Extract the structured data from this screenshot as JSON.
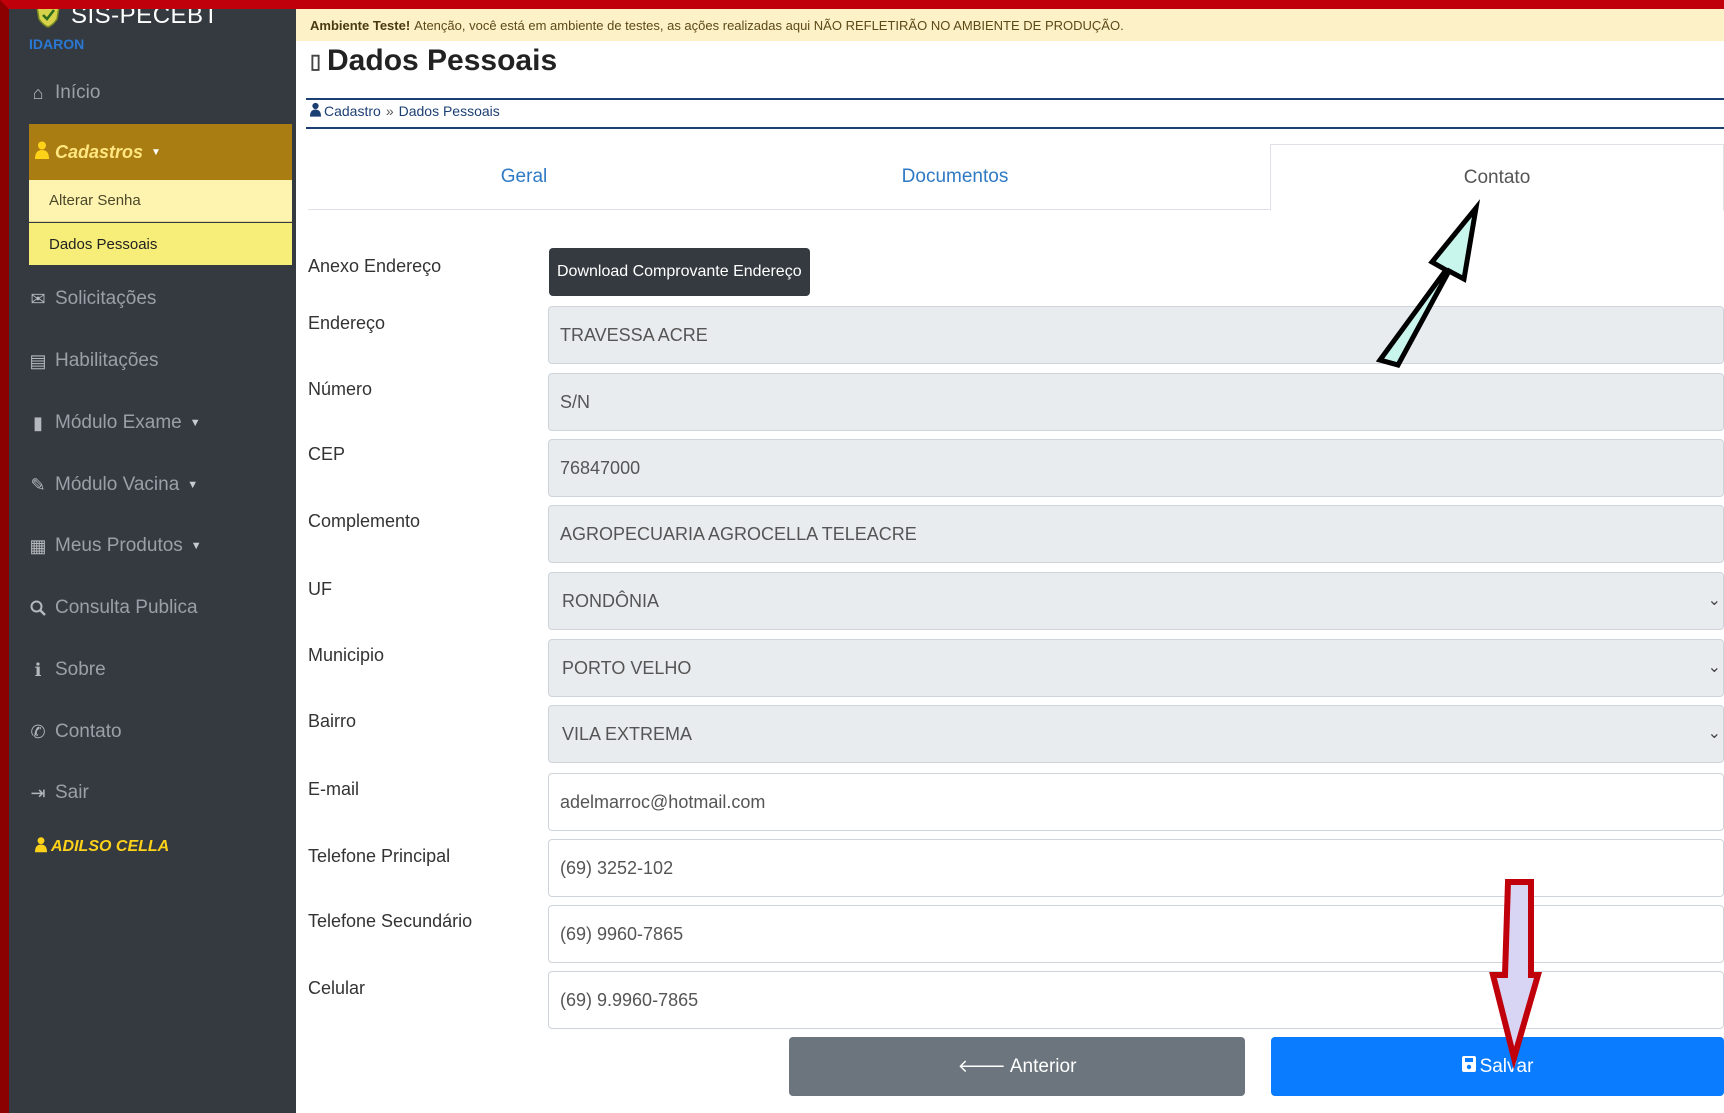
{
  "app": {
    "name": "SIS-PECEBT",
    "org": "IDARON"
  },
  "sidebar": {
    "items": [
      {
        "label": "Início",
        "icon": "home-icon"
      },
      {
        "label": "Cadastros",
        "icon": "user-icon",
        "active": true
      },
      {
        "label": "Solicitações",
        "icon": "envelope-icon"
      },
      {
        "label": "Habilitações",
        "icon": "document-icon"
      },
      {
        "label": "Módulo Exame",
        "icon": "file-icon"
      },
      {
        "label": "Módulo Vacina",
        "icon": "syringe-icon"
      },
      {
        "label": "Meus Produtos",
        "icon": "box-icon"
      },
      {
        "label": "Consulta Publica",
        "icon": "search-icon"
      },
      {
        "label": "Sobre",
        "icon": "info-icon"
      },
      {
        "label": "Contato",
        "icon": "phone-icon"
      },
      {
        "label": "Sair",
        "icon": "logout-icon"
      }
    ],
    "submenu": [
      "Alterar Senha",
      "Dados Pessoais"
    ],
    "user": "ADILSO CELLA"
  },
  "alert": {
    "title": "Ambiente Teste!",
    "text": "Atenção, você está em ambiente de testes, as ações realizadas aqui NÃO REFLETIRÃO NO AMBIENTE DE PRODUÇÃO."
  },
  "page": {
    "title": "Dados Pessoais",
    "breadcrumb": [
      "Cadastro",
      "Dados Pessoais"
    ]
  },
  "tabs": [
    "Geral",
    "Documentos",
    "Contato"
  ],
  "form": {
    "anexo_label": "Anexo Endereço",
    "download_label": "Download Comprovante Endereço",
    "fields": [
      {
        "label": "Endereço",
        "value": "TRAVESSA ACRE"
      },
      {
        "label": "Número",
        "value": "S/N"
      },
      {
        "label": "CEP",
        "value": "76847000"
      },
      {
        "label": "Complemento",
        "value": "AGROPECUARIA AGROCELLA  TELEACRE"
      },
      {
        "label": "UF",
        "value": "RONDÔNIA"
      },
      {
        "label": "Municipio",
        "value": "PORTO VELHO"
      },
      {
        "label": "Bairro",
        "value": "VILA EXTREMA"
      },
      {
        "label": "E-mail",
        "value": "adelmarroc@hotmail.com"
      },
      {
        "label": "Telefone Principal",
        "value": "(69) 3252-102"
      },
      {
        "label": "Telefone Secundário",
        "value": "(69) 9960-7865"
      },
      {
        "label": "Celular",
        "value": "(69) 9.9960-7865"
      }
    ]
  },
  "buttons": {
    "prev": "Anterior",
    "save": "Salvar"
  },
  "colors": {
    "sidebar": "#343a40",
    "active_menu": "#aa7d12",
    "primary": "#0a7cff",
    "secondary": "#6c757d",
    "arrow_up_fill": "#c8f5ec",
    "arrow_down_fill": "#d8d4f4",
    "arrow_down_stroke": "#c0000a"
  }
}
